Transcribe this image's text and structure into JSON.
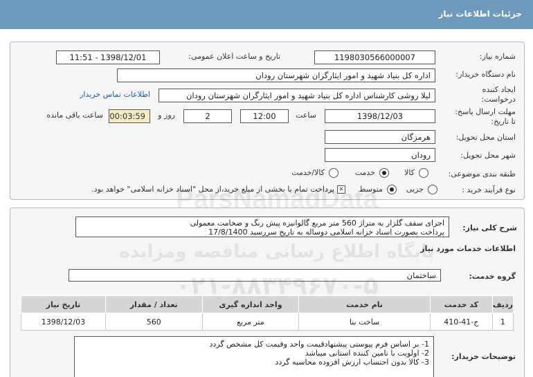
{
  "page": {
    "title": "جزئیات اطلاعات نیاز"
  },
  "need_number": {
    "label": "شماره نیاز:",
    "value": "1198030566000007"
  },
  "announce": {
    "label": "تاریخ و ساعت اعلان عمومی:",
    "value": "1398/12/01 - 11:51"
  },
  "buyer": {
    "label": "نام دستگاه خریدار:",
    "value": "اداره کل بنیاد شهید و امور ایثارگران شهرستان رودان"
  },
  "creator": {
    "label_line1": "ایجاد کننده",
    "label_line2": "درخواست:",
    "value": "لیلا روشی کارشناس  اداره کل بنیاد شهید و امور ایثارگران شهرستان رودان",
    "contact_link": "اطلاعات تماس خریدار"
  },
  "deadline": {
    "label_line1": "مهلت ارسال پاسخ:",
    "label_line2": "تا تاریخ:",
    "date": "1398/12/03",
    "time_label": "ساعت",
    "time": "12:00",
    "days_label": "روز و",
    "days": "2",
    "timer": "00:03:59",
    "remaining_label": "ساعت باقی مانده"
  },
  "province": {
    "label": "استان محل تحویل:",
    "value": "هرمزگان"
  },
  "city": {
    "label": "شهر محل تحویل:",
    "value": "رودان"
  },
  "category": {
    "label": "طبقه بندی موضوعی:",
    "options": [
      "کالا",
      "خدمت",
      "کالا/خدمت"
    ],
    "selected": "خدمت"
  },
  "process": {
    "label": "نوع فرآیند خرید :",
    "options": [
      "جزیی",
      "متوسط"
    ],
    "selected": "متوسط",
    "payment_note": "پرداخت تمام یا بخشی از مبلغ خرید،از محل \"اسناد خزانه اسلامی\" خواهد بود."
  },
  "summary": {
    "label": "شرح کلی نیاز:",
    "lines": [
      "اجرای سقف گلزار به متراژ 560  متر مربع گالوانیزه پیش رنگ و ضخامت معمولی",
      "پرداخت بصورت اسناد خزانه اسلامی دوساله به تاریخ سررسید 17/8/1400"
    ]
  },
  "services_info": {
    "heading": "اطلاعات خدمات مورد نیاز"
  },
  "service_group": {
    "label": "گروه خدمت:",
    "value": "ساختمان"
  },
  "table": {
    "headers": [
      "ردیف",
      "کد خدمت",
      "نام خدمت",
      "واحد اندازه گیری",
      "تعداد / مقدار",
      "تاریخ نیاز"
    ],
    "rows": [
      [
        "1",
        "ج-41-410",
        "ساخت بنا",
        "متر مربع",
        "560",
        "1398/12/03"
      ]
    ]
  },
  "buyer_notes": {
    "label": "توضیحات خریدار:",
    "lines": [
      "1-  بر اساس فرم  پیوستی پیشنهادقیمت واحد وقیمت کل مشخص گردد",
      "2- اولویت با تامین کننده استانی میباشد",
      "3- کالا بدون احتساب ارزش افزوده محاسبه گردد"
    ]
  },
  "watermark": {
    "line1": "ParsNamadData",
    "line2": "پایگاه اطلاع رسانی مناقصه ومزایده",
    "line3": "۰۲۱-۸۸۳۴۹۶۷۰-۵"
  }
}
